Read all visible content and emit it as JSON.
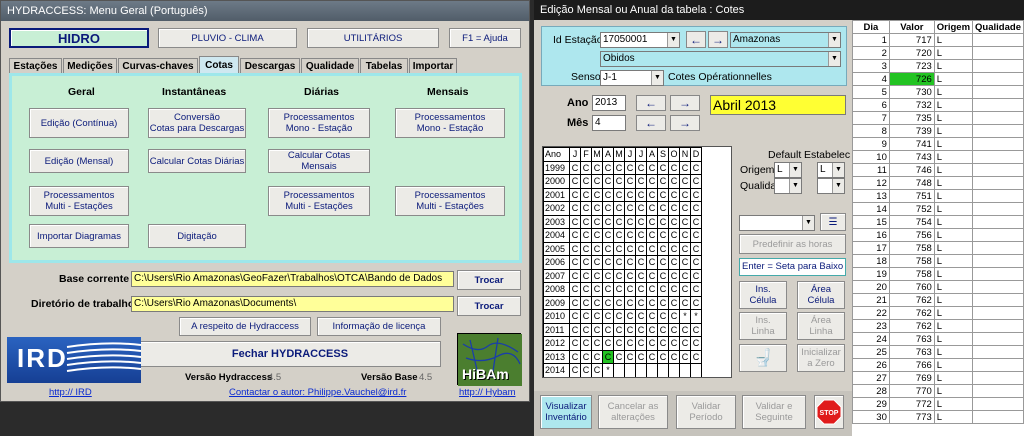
{
  "w1": {
    "title": "HYDRACCESS: Menu Geral (Português)",
    "top_buttons": [
      "HIDRO",
      "PLUVIO - CLIMA",
      "UTILITÁRIOS",
      "F1 = Ajuda"
    ],
    "tabs": [
      "Estações",
      "Medições",
      "Curvas-chaves",
      "Cotas",
      "Descargas",
      "Qualidade",
      "Tabelas",
      "Importar"
    ],
    "col_heads": [
      "Geral",
      "Instantâneas",
      "Diárias",
      "Mensais"
    ],
    "panel_buttons": {
      "edicao_continua": "Edição (Contínua)",
      "conversao": "Conversão\nCotas para Descargas",
      "proc_mono_d": "Processamentos\nMono - Estação",
      "proc_mono_m": "Processamentos\nMono - Estação",
      "edicao_mensal": "Edição (Mensal)",
      "calc_diarias": "Calcular Cotas Diárias",
      "calc_mensais": "Calcular Cotas Mensais",
      "proc_multi_g": "Processamentos\nMulti - Estações",
      "proc_multi_d": "Processamentos\nMulti - Estações",
      "proc_multi_m": "Processamentos\nMulti - Estações",
      "importar": "Importar Diagramas",
      "digitacao": "Digitação"
    },
    "base_label": "Base corrente",
    "base_value": "C:\\Users\\Rio Amazonas\\GeoFazer\\Trabalhos\\OTCA\\Bando de Dados",
    "dir_label": "Diretório de trabalho",
    "dir_value": "C:\\Users\\Rio Amazonas\\Documents\\",
    "trocar": "Trocar",
    "respeito": "A respeito de Hydraccess",
    "licenca": "Informação de licença",
    "fechar": "Fechar HYDRACCESS",
    "versao_hyd_label": "Versão Hydraccess",
    "versao_hyd": "4.5",
    "versao_base_label": "Versão Base",
    "versao_base": "4.5",
    "ird_logo": "IRD",
    "hibam_logo": "HiBAm",
    "link_ird": "http:// IRD",
    "contact": "Contactar o autor: Philippe.Vauchel@ird.fr",
    "link_hybam": "http:// Hybam"
  },
  "w2": {
    "title": "Edição Mensal ou Anual da tabela : Cotes",
    "id_label": "Id Estação",
    "id_value": "17050001",
    "river": "Amazonas",
    "station": "Obidos",
    "sensor_label": "Sensor",
    "sensor_value": "J-1",
    "sensor_desc": "Cotes Opérationnelles",
    "ano_label": "Ano",
    "ano_value": "2013",
    "mes_label": "Mês",
    "mes_value": "4",
    "period": "Abril 2013",
    "grid_header": [
      "Ano",
      "J",
      "F",
      "M",
      "A",
      "M",
      "J",
      "J",
      "A",
      "S",
      "O",
      "N",
      "D"
    ],
    "grid_rows": [
      [
        "1999",
        "C",
        "C",
        "C",
        "C",
        "C",
        "C",
        "C",
        "C",
        "C",
        "C",
        "C",
        "C"
      ],
      [
        "2000",
        "C",
        "C",
        "C",
        "C",
        "C",
        "C",
        "C",
        "C",
        "C",
        "C",
        "C",
        "C"
      ],
      [
        "2001",
        "C",
        "C",
        "C",
        "C",
        "C",
        "C",
        "C",
        "C",
        "C",
        "C",
        "C",
        "C"
      ],
      [
        "2002",
        "C",
        "C",
        "C",
        "C",
        "C",
        "C",
        "C",
        "C",
        "C",
        "C",
        "C",
        "C"
      ],
      [
        "2003",
        "C",
        "C",
        "C",
        "C",
        "C",
        "C",
        "C",
        "C",
        "C",
        "C",
        "C",
        "C"
      ],
      [
        "2004",
        "C",
        "C",
        "C",
        "C",
        "C",
        "C",
        "C",
        "C",
        "C",
        "C",
        "C",
        "C"
      ],
      [
        "2005",
        "C",
        "C",
        "C",
        "C",
        "C",
        "C",
        "C",
        "C",
        "C",
        "C",
        "C",
        "C"
      ],
      [
        "2006",
        "C",
        "C",
        "C",
        "C",
        "C",
        "C",
        "C",
        "C",
        "C",
        "C",
        "C",
        "C"
      ],
      [
        "2007",
        "C",
        "C",
        "C",
        "C",
        "C",
        "C",
        "C",
        "C",
        "C",
        "C",
        "C",
        "C"
      ],
      [
        "2008",
        "C",
        "C",
        "C",
        "C",
        "C",
        "C",
        "C",
        "C",
        "C",
        "C",
        "C",
        "C"
      ],
      [
        "2009",
        "C",
        "C",
        "C",
        "C",
        "C",
        "C",
        "C",
        "C",
        "C",
        "C",
        "C",
        "C"
      ],
      [
        "2010",
        "C",
        "C",
        "C",
        "C",
        "C",
        "C",
        "C",
        "C",
        "C",
        "C",
        "*",
        "*"
      ],
      [
        "2011",
        "C",
        "C",
        "C",
        "C",
        "C",
        "C",
        "C",
        "C",
        "C",
        "C",
        "C",
        "C"
      ],
      [
        "2012",
        "C",
        "C",
        "C",
        "C",
        "C",
        "C",
        "C",
        "C",
        "C",
        "C",
        "C",
        "C"
      ],
      [
        "2013",
        "C",
        "C",
        "C",
        "C",
        "C",
        "C",
        "C",
        "C",
        "C",
        "C",
        "C",
        "C"
      ],
      [
        "2014",
        "C",
        "C",
        "C",
        "*",
        "",
        "",
        "",
        "",
        "",
        "",
        "",
        ""
      ]
    ],
    "default_label": "Default",
    "estab_label": "Estabelecer",
    "origem_label": "Origem",
    "qualidade_label": "Qualidade",
    "origem_default": "L",
    "origem_estab": "L",
    "predefinir": "Predefinir as horas",
    "enter_hint": "Enter = Seta para Baixo",
    "ins_celula": "Ins.\nCélula",
    "area_celula": "Área\nCélula",
    "ins_linha": "Ins.\nLinha",
    "area_linha": "Área\nLinha",
    "inicializar": "Inicializar\na Zero",
    "visualizar": "Visualizar\nInventário",
    "cancelar": "Cancelar as\nalterações",
    "validar_periodo": "Validar\nPeríodo",
    "validar_seguinte": "Validar e\nSeguinte",
    "stop": "STOP",
    "day_header": [
      "Dia",
      "Valor",
      "Origem",
      "Qualidade"
    ],
    "days": [
      [
        "1",
        "717",
        "L",
        ""
      ],
      [
        "2",
        "720",
        "L",
        ""
      ],
      [
        "3",
        "723",
        "L",
        ""
      ],
      [
        "4",
        "726",
        "L",
        ""
      ],
      [
        "5",
        "730",
        "L",
        ""
      ],
      [
        "6",
        "732",
        "L",
        ""
      ],
      [
        "7",
        "735",
        "L",
        ""
      ],
      [
        "8",
        "739",
        "L",
        ""
      ],
      [
        "9",
        "741",
        "L",
        ""
      ],
      [
        "10",
        "743",
        "L",
        ""
      ],
      [
        "11",
        "746",
        "L",
        ""
      ],
      [
        "12",
        "748",
        "L",
        ""
      ],
      [
        "13",
        "751",
        "L",
        ""
      ],
      [
        "14",
        "752",
        "L",
        ""
      ],
      [
        "15",
        "754",
        "L",
        ""
      ],
      [
        "16",
        "756",
        "L",
        ""
      ],
      [
        "17",
        "758",
        "L",
        ""
      ],
      [
        "18",
        "758",
        "L",
        ""
      ],
      [
        "19",
        "758",
        "L",
        ""
      ],
      [
        "20",
        "760",
        "L",
        ""
      ],
      [
        "21",
        "762",
        "L",
        ""
      ],
      [
        "22",
        "762",
        "L",
        ""
      ],
      [
        "23",
        "762",
        "L",
        ""
      ],
      [
        "24",
        "763",
        "L",
        ""
      ],
      [
        "25",
        "763",
        "L",
        ""
      ],
      [
        "26",
        "766",
        "L",
        ""
      ],
      [
        "27",
        "769",
        "L",
        ""
      ],
      [
        "28",
        "770",
        "L",
        ""
      ],
      [
        "29",
        "772",
        "L",
        ""
      ],
      [
        "30",
        "773",
        "L",
        ""
      ]
    ],
    "colors": {
      "highlight": "#22c322",
      "yellow": "#ffff66",
      "cyan_panel": "#9ee7ea"
    }
  }
}
